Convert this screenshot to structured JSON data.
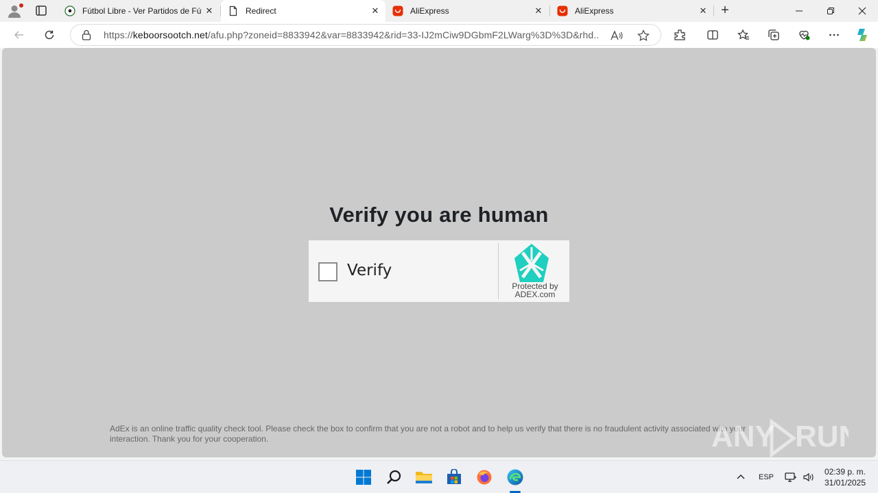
{
  "browser": {
    "tabs": [
      {
        "title": "Fútbol Libre - Ver Partidos de Fútbol",
        "active": false,
        "favicon": "soccer-ball-icon"
      },
      {
        "title": "Redirect",
        "active": true,
        "favicon": "page-icon"
      },
      {
        "title": "AliExpress",
        "active": false,
        "favicon": "aliexpress-icon"
      },
      {
        "title": "AliExpress",
        "active": false,
        "favicon": "aliexpress-icon"
      }
    ],
    "url_prefix": "https://",
    "url_host": "keboorsootch.net",
    "url_path": "/afu.php?zoneid=8833942&var=8833942&rid=33-IJ2mCiw9DGbmF2LWarg%3D%3D&rhd...",
    "accent": "#0067c0"
  },
  "page": {
    "heading": "Verify you are human",
    "checkbox_label": "Verify",
    "protected_line1": "Protected by",
    "protected_line2": "ADEX.com",
    "notice": "AdEx is an online traffic quality check tool. Please check the box to confirm that you are not a robot and to help us verify that there is no fraudulent activity associated with your interaction. Thank you for your cooperation.",
    "background": "#cbcbcb",
    "logo_color": "#1fcfbf"
  },
  "watermark": {
    "text": "ANY RUN"
  },
  "taskbar": {
    "language": "ESP",
    "time": "02:39 p. m.",
    "date": "31/01/2025"
  }
}
